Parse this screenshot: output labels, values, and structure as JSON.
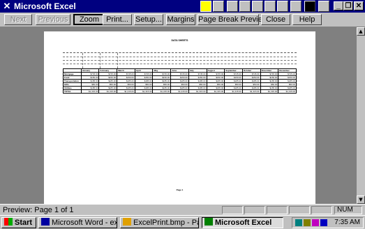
{
  "window": {
    "title": "Microsoft Excel"
  },
  "toolbar": {
    "next": "Next",
    "previous": "Previous",
    "zoom": "Zoom",
    "print": "Print...",
    "setup": "Setup...",
    "margins": "Margins",
    "page_break_preview": "Page Break Preview",
    "close": "Close",
    "help": "Help"
  },
  "sheet": {
    "title": "DATA SHEETS",
    "columns": [
      "",
      "January",
      "February",
      "March",
      "April",
      "May",
      "June",
      "July",
      "August",
      "September",
      "October",
      "November",
      "December"
    ],
    "rows": [
      {
        "label": "Mortgage",
        "values": [
          "$745.00",
          "$745.00",
          "$745.00",
          "$745.00",
          "$745.00",
          "$745.00",
          "$745.00",
          "$745.00",
          "$745.00",
          "$745.00",
          "$745.00",
          "$745.00"
        ]
      },
      {
        "label": "Food",
        "values": [
          "$150.00",
          "$150.00",
          "$150.00",
          "$150.00",
          "$150.00",
          "$150.00",
          "$150.00",
          "$150.00",
          "$150.00",
          "$150.00",
          "$150.00",
          "$150.00"
        ]
      },
      {
        "label": "Transportation",
        "values": [
          "$185.00",
          "$185.00",
          "$185.00",
          "$185.00",
          "$185.00",
          "$185.00",
          "$185.00",
          "$185.00",
          "$185.00",
          "$185.00",
          "$185.00",
          "$185.00"
        ]
      },
      {
        "label": "Gifts",
        "values": [
          "$50.00",
          "$50.00",
          "$50.00",
          "$50.00",
          "$50.00",
          "$50.00",
          "$50.00",
          "$50.00",
          "$50.00",
          "$50.00",
          "$50.00",
          "$50.00"
        ]
      },
      {
        "label": "Utilities",
        "values": [
          "$185.00",
          "$185.00",
          "$185.00",
          "$185.00",
          "$185.00",
          "$185.00",
          "$185.00",
          "$185.00",
          "$185.00",
          "$185.00",
          "$185.00",
          "$185.00"
        ]
      },
      {
        "label": "TOTAL",
        "values": [
          "$1,315.00",
          "$1,315.00",
          "$1,315.00",
          "$1,315.00",
          "$1,315.00",
          "$1,315.00",
          "$1,315.00",
          "$1,315.00",
          "$1,315.00",
          "$1,315.00",
          "$1,315.00",
          "$1,315.00"
        ]
      }
    ],
    "footer": "Page 1"
  },
  "status": {
    "text": "Preview: Page 1 of 1",
    "num": "NUM"
  },
  "taskbar": {
    "start": "Start",
    "items": [
      "Microsoft Word - excel...",
      "ExcelPrint.bmp - Paint",
      "Microsoft Excel"
    ],
    "clock": "7:35 AM"
  }
}
